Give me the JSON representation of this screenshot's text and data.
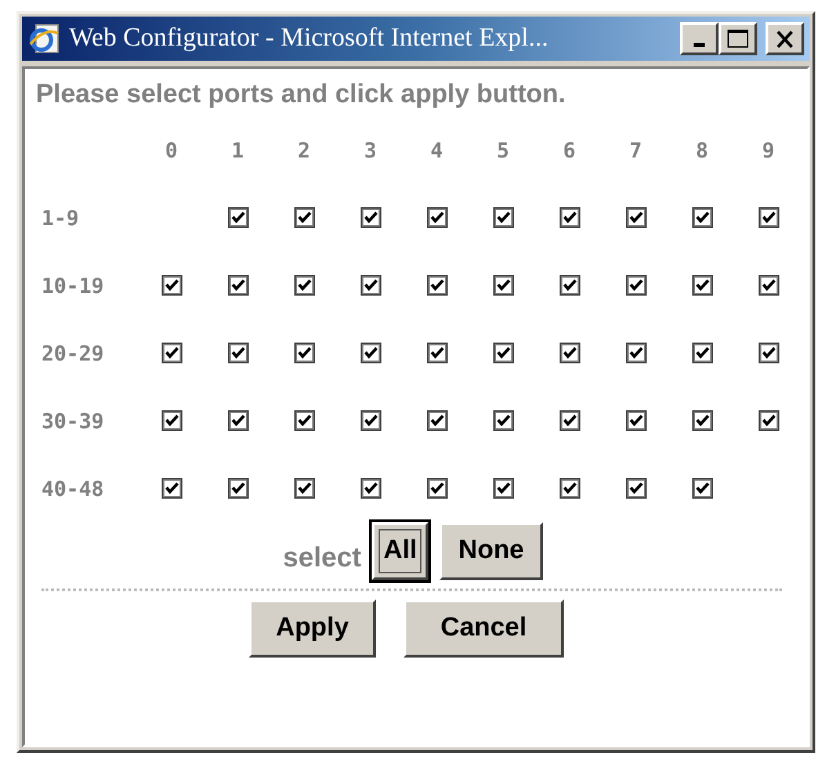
{
  "window": {
    "title": "Web Configurator - Microsoft Internet Expl..."
  },
  "instruction": "Please select ports and click apply button.",
  "columns": [
    "0",
    "1",
    "2",
    "3",
    "4",
    "5",
    "6",
    "7",
    "8",
    "9"
  ],
  "rows": [
    {
      "label": "1-9",
      "cells": [
        {
          "kind": "empty"
        },
        {
          "kind": "box",
          "checked": true
        },
        {
          "kind": "box",
          "checked": true
        },
        {
          "kind": "box",
          "checked": true
        },
        {
          "kind": "box",
          "checked": true
        },
        {
          "kind": "box",
          "checked": true
        },
        {
          "kind": "box",
          "checked": true
        },
        {
          "kind": "box",
          "checked": true
        },
        {
          "kind": "box",
          "checked": true
        },
        {
          "kind": "box",
          "checked": true
        }
      ]
    },
    {
      "label": "10-19",
      "cells": [
        {
          "kind": "box",
          "checked": true
        },
        {
          "kind": "box",
          "checked": true
        },
        {
          "kind": "box",
          "checked": true
        },
        {
          "kind": "box",
          "checked": true
        },
        {
          "kind": "box",
          "checked": true
        },
        {
          "kind": "box",
          "checked": true
        },
        {
          "kind": "box",
          "checked": true
        },
        {
          "kind": "box",
          "checked": true
        },
        {
          "kind": "box",
          "checked": true
        },
        {
          "kind": "box",
          "checked": true
        }
      ]
    },
    {
      "label": "20-29",
      "cells": [
        {
          "kind": "box",
          "checked": true
        },
        {
          "kind": "box",
          "checked": true
        },
        {
          "kind": "box",
          "checked": true
        },
        {
          "kind": "box",
          "checked": true
        },
        {
          "kind": "box",
          "checked": true
        },
        {
          "kind": "box",
          "checked": true
        },
        {
          "kind": "box",
          "checked": true
        },
        {
          "kind": "box",
          "checked": true
        },
        {
          "kind": "box",
          "checked": true
        },
        {
          "kind": "box",
          "checked": true
        }
      ]
    },
    {
      "label": "30-39",
      "cells": [
        {
          "kind": "box",
          "checked": true
        },
        {
          "kind": "box",
          "checked": true
        },
        {
          "kind": "box",
          "checked": true
        },
        {
          "kind": "box",
          "checked": true
        },
        {
          "kind": "box",
          "checked": true
        },
        {
          "kind": "box",
          "checked": true
        },
        {
          "kind": "box",
          "checked": true
        },
        {
          "kind": "box",
          "checked": true
        },
        {
          "kind": "box",
          "checked": true
        },
        {
          "kind": "box",
          "checked": true
        }
      ]
    },
    {
      "label": "40-48",
      "cells": [
        {
          "kind": "box",
          "checked": true
        },
        {
          "kind": "box",
          "checked": true
        },
        {
          "kind": "box",
          "checked": true
        },
        {
          "kind": "box",
          "checked": true
        },
        {
          "kind": "box",
          "checked": true
        },
        {
          "kind": "box",
          "checked": true
        },
        {
          "kind": "box",
          "checked": true
        },
        {
          "kind": "box",
          "checked": true
        },
        {
          "kind": "box",
          "checked": true
        },
        {
          "kind": "empty"
        }
      ]
    }
  ],
  "select_label": "select",
  "select_buttons": [
    {
      "label": "All",
      "focused": true
    },
    {
      "label": "None",
      "focused": false
    }
  ],
  "action_buttons": [
    {
      "label": "Apply",
      "focused": false
    },
    {
      "label": "Cancel",
      "focused": false
    }
  ]
}
